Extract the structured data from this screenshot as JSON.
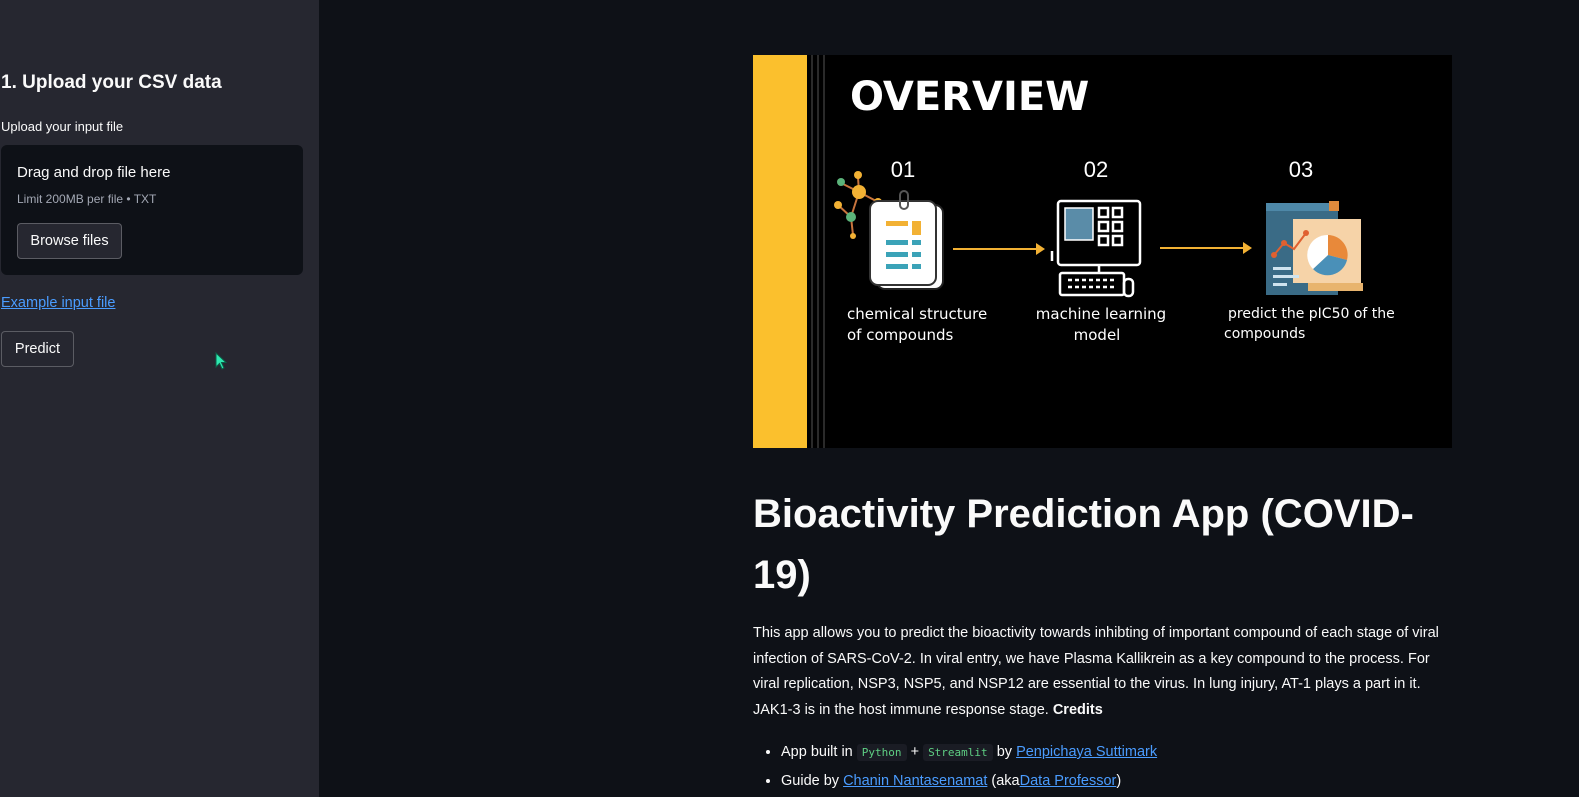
{
  "sidebar": {
    "title": "1. Upload your CSV data",
    "upload_label": "Upload your input file",
    "dropzone_title": "Drag and drop file here",
    "dropzone_limit": "Limit 200MB per file • TXT",
    "browse_label": "Browse files",
    "example_link": "Example input file",
    "predict_label": "Predict"
  },
  "banner": {
    "heading": "OVERVIEW",
    "accent_color": "#fbc02d",
    "steps": [
      {
        "num": "01",
        "line1": "chemical structure",
        "line2": "of compounds"
      },
      {
        "num": "02",
        "line1": "machine learning",
        "line2": "model"
      },
      {
        "num": "03",
        "line1": "predict the pIC50 of the",
        "line2": "compounds"
      }
    ]
  },
  "main": {
    "title": "Bioactivity Prediction App (COVID-19)",
    "description": "This app allows you to predict the bioactivity towards inhibting of important compound of each stage of viral infection of SARS-CoV-2. In viral entry, we have Plasma Kallikrein as a key compound to the process. For viral replication, NSP3, NSP5, and NSP12 are essential to the virus. In lung injury, AT-1 plays a part in it. JAK1-3 is in the host immune response stage.",
    "credits_label": "Credits",
    "credits": {
      "item1_prefix": "App built in",
      "code1": "Python",
      "plus": "+",
      "code2": "Streamlit",
      "by": "by",
      "author_link": "Penpichaya Suttimark",
      "item2_prefix": "Guide by",
      "guide_link": "Chanin Nantasenamat",
      "aka_open": "(aka",
      "aka_link": "Data Professor",
      "aka_close": ")"
    }
  },
  "colors": {
    "background": "#0e1117",
    "sidebar": "#262730",
    "link": "#4a9cff",
    "code_text": "#5ece83"
  }
}
